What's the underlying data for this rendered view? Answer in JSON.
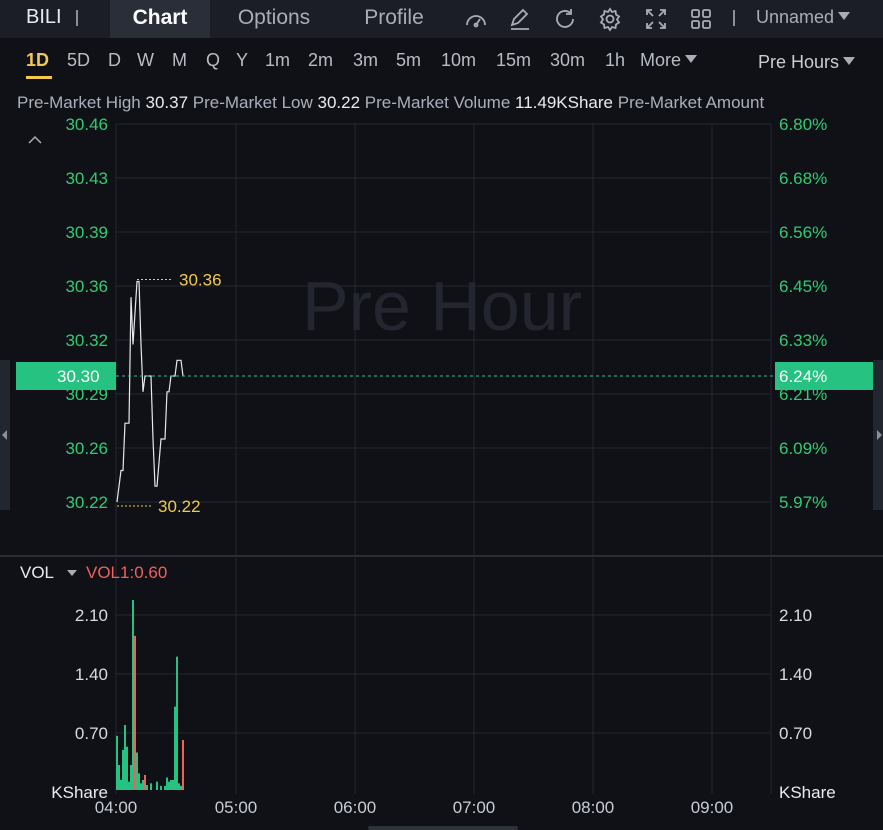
{
  "header": {
    "symbol": "BILI",
    "tabs": [
      {
        "label": "Chart",
        "active": true
      },
      {
        "label": "Options",
        "active": false
      },
      {
        "label": "Profile",
        "active": false
      }
    ],
    "tool_icons": [
      "indicator-gauge-icon",
      "draw-pen-icon",
      "refresh-icon",
      "settings-gear-icon",
      "fullscreen-icon",
      "layout-grid-icon"
    ],
    "layout_name": "Unnamed"
  },
  "periods": {
    "items": [
      "1D",
      "5D",
      "D",
      "W",
      "M",
      "Q",
      "Y",
      "1m",
      "2m",
      "3m",
      "5m",
      "10m",
      "15m",
      "30m",
      "1h",
      "More"
    ],
    "active": "1D",
    "session": "Pre Hours"
  },
  "stats": {
    "high_label": "Pre-Market High",
    "high_value": "30.37",
    "low_label": "Pre-Market Low",
    "low_value": "30.22",
    "volume_label": "Pre-Market Volume",
    "volume_value": "11.49KShare",
    "amount_label": "Pre-Market Amount"
  },
  "colors": {
    "up": "#26c281",
    "down": "#f0605d",
    "marker": "#f2c94c",
    "line": "#e8e8ec",
    "axis_text": "#2ecc71"
  },
  "chart_data": [
    {
      "type": "line",
      "watermark": "Pre Hour",
      "x_ticks": [
        "04:00",
        "05:00",
        "06:00",
        "07:00",
        "08:00",
        "09:00"
      ],
      "y_ticks": [
        "30.46",
        "30.43",
        "30.39",
        "30.36",
        "30.32",
        "30.29",
        "30.26",
        "30.22"
      ],
      "y_pct_ticks": [
        "6.80%",
        "6.68%",
        "6.56%",
        "6.45%",
        "6.33%",
        "6.21%",
        "6.09%",
        "5.97%"
      ],
      "ylim": [
        30.22,
        30.46
      ],
      "current_price": "30.30",
      "current_pct": "6.24%",
      "high_marker": "30.36",
      "low_marker": "30.22",
      "x_minutes": [
        0,
        2,
        3,
        4,
        6,
        7,
        8,
        10,
        11,
        12,
        13,
        14,
        15,
        16,
        17,
        18,
        19,
        20,
        22,
        24,
        25,
        26,
        27,
        29,
        30,
        31,
        32,
        33
      ],
      "y": [
        30.22,
        30.24,
        30.24,
        30.27,
        30.27,
        30.35,
        30.32,
        30.36,
        30.36,
        30.32,
        30.29,
        30.3,
        30.3,
        30.3,
        30.3,
        30.26,
        30.23,
        30.23,
        30.26,
        30.26,
        30.29,
        30.29,
        30.3,
        30.3,
        30.31,
        30.31,
        30.31,
        30.3
      ]
    },
    {
      "type": "bar",
      "indicator": "VOL",
      "indicator_value": "VOL1:0.60",
      "y_ticks": [
        "2.10",
        "1.40",
        "0.70"
      ],
      "unit": "KShare",
      "ylim": [
        0,
        2.3
      ],
      "bars": [
        {
          "m": 0,
          "v": 0.65,
          "up": true
        },
        {
          "m": 1,
          "v": 0.3,
          "up": true
        },
        {
          "m": 2,
          "v": 0.12,
          "up": true
        },
        {
          "m": 3,
          "v": 0.48,
          "up": true
        },
        {
          "m": 4,
          "v": 0.78,
          "up": true
        },
        {
          "m": 5,
          "v": 0.52,
          "up": true
        },
        {
          "m": 6,
          "v": 0.1,
          "up": true
        },
        {
          "m": 7,
          "v": 0.3,
          "up": true
        },
        {
          "m": 8,
          "v": 2.28,
          "up": true
        },
        {
          "m": 9,
          "v": 1.85,
          "up": false
        },
        {
          "m": 10,
          "v": 0.45,
          "up": true
        },
        {
          "m": 11,
          "v": 0.2,
          "up": true
        },
        {
          "m": 12,
          "v": 0.08,
          "up": true
        },
        {
          "m": 13,
          "v": 0.12,
          "up": true
        },
        {
          "m": 14,
          "v": 0.18,
          "up": false
        },
        {
          "m": 15,
          "v": 0.06,
          "up": true
        },
        {
          "m": 17,
          "v": 0.08,
          "up": true
        },
        {
          "m": 20,
          "v": 0.1,
          "up": true
        },
        {
          "m": 22,
          "v": 0.05,
          "up": true
        },
        {
          "m": 24,
          "v": 0.05,
          "up": true
        },
        {
          "m": 25,
          "v": 0.15,
          "up": true
        },
        {
          "m": 26,
          "v": 0.1,
          "up": true
        },
        {
          "m": 27,
          "v": 0.12,
          "up": true
        },
        {
          "m": 28,
          "v": 0.12,
          "up": true
        },
        {
          "m": 29,
          "v": 1.0,
          "up": true
        },
        {
          "m": 30,
          "v": 1.6,
          "up": true
        },
        {
          "m": 31,
          "v": 0.08,
          "up": true
        },
        {
          "m": 32,
          "v": 0.05,
          "up": true
        },
        {
          "m": 33,
          "v": 0.6,
          "up": false
        }
      ]
    }
  ]
}
